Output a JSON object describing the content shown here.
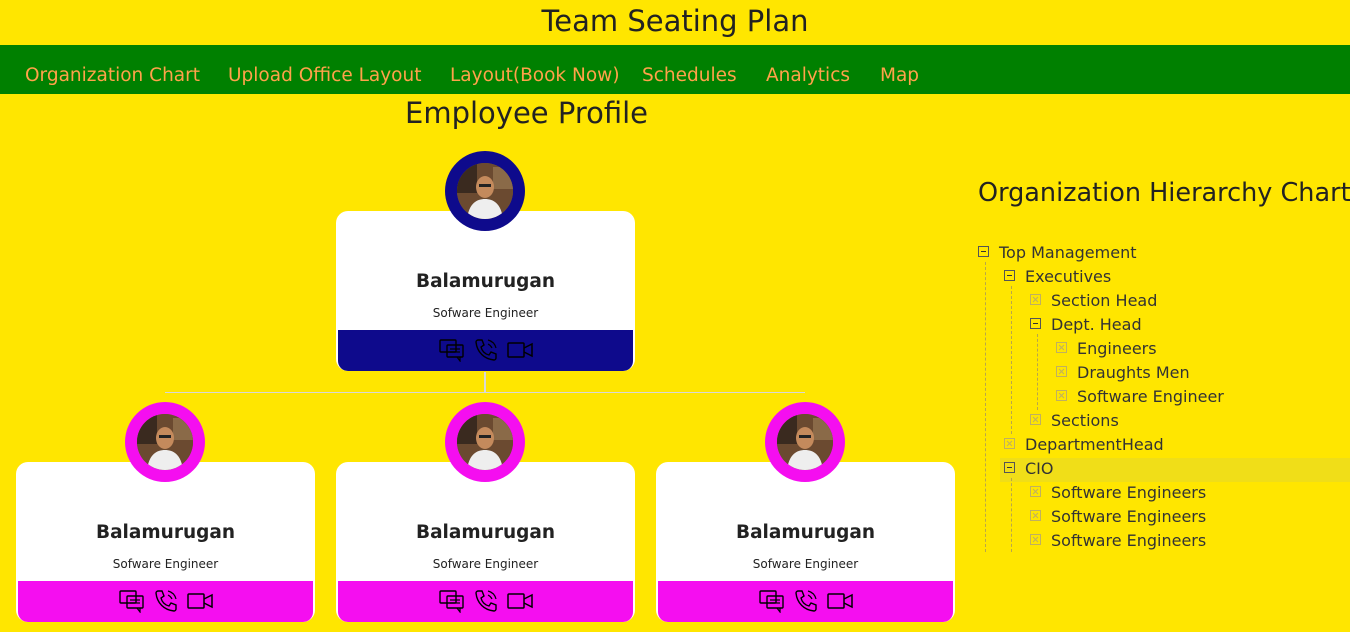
{
  "app": {
    "title": "Team Seating Plan"
  },
  "nav": {
    "items": [
      {
        "label": "Organization Chart"
      },
      {
        "label": "Upload Office Layout"
      },
      {
        "label": "Layout(Book Now)"
      },
      {
        "label": "Schedules"
      },
      {
        "label": "Analytics"
      },
      {
        "label": "Map"
      }
    ]
  },
  "profile": {
    "title": "Employee Profile",
    "manager": {
      "name": "Balamurugan",
      "role": "Sofware Engineer",
      "color": "#0e0a8c"
    },
    "reports": [
      {
        "name": "Balamurugan",
        "role": "Sofware Engineer",
        "color": "#f50ef0"
      },
      {
        "name": "Balamurugan",
        "role": "Sofware Engineer",
        "color": "#f50ef0"
      },
      {
        "name": "Balamurugan",
        "role": "Sofware Engineer",
        "color": "#f50ef0"
      }
    ],
    "card_icons": [
      "chat-icon",
      "phone-icon",
      "video-icon"
    ]
  },
  "hierarchy": {
    "title": "Organization Hierarchy Chart",
    "nodes": [
      {
        "label": "Top Management",
        "state": "expanded"
      },
      {
        "label": "Executives",
        "state": "expanded"
      },
      {
        "label": "Section Head",
        "state": "leaf"
      },
      {
        "label": "Dept. Head",
        "state": "expanded"
      },
      {
        "label": "Engineers",
        "state": "leaf"
      },
      {
        "label": "Draughts Men",
        "state": "leaf"
      },
      {
        "label": "Software Engineer",
        "state": "leaf"
      },
      {
        "label": "Sections",
        "state": "leaf"
      },
      {
        "label": "DepartmentHead",
        "state": "leaf"
      },
      {
        "label": "CIO",
        "state": "expanded",
        "selected": true
      },
      {
        "label": "Software Engineers",
        "state": "leaf"
      },
      {
        "label": "Software Engineers",
        "state": "leaf"
      },
      {
        "label": "Software Engineers",
        "state": "leaf"
      }
    ]
  },
  "colors": {
    "background": "#ffe600",
    "nav": "#008000",
    "nav_text": "#ffa24a"
  }
}
